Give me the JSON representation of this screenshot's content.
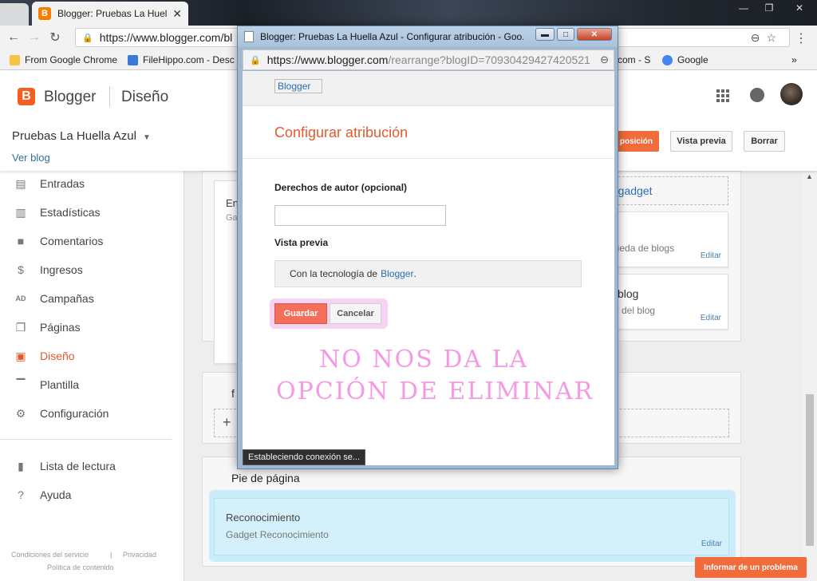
{
  "browser": {
    "tab_title": "Blogger: Pruebas La Huel",
    "address_url": "https://www.blogger.com/bl",
    "bookmarks": [
      "From Google Chrome",
      "FileHippo.com - Desc",
      "com - S",
      "Google"
    ]
  },
  "blogger": {
    "brand": "Blogger",
    "section": "Diseño",
    "blog_title": "Pruebas La Huella Azul",
    "view_blog": "Ver blog",
    "btn_save_arrangement": "posición",
    "btn_preview": "Vista previa",
    "btn_delete": "Borrar"
  },
  "sidebar": {
    "items": [
      {
        "label": "Entradas",
        "icon": "posts-icon"
      },
      {
        "label": "Estadísticas",
        "icon": "stats-icon"
      },
      {
        "label": "Comentarios",
        "icon": "comments-icon"
      },
      {
        "label": "Ingresos",
        "icon": "dollar-icon"
      },
      {
        "label": "Campañas",
        "icon": "ads-icon"
      },
      {
        "label": "Páginas",
        "icon": "pages-icon"
      },
      {
        "label": "Diseño",
        "icon": "layout-icon"
      },
      {
        "label": "Plantilla",
        "icon": "template-icon"
      },
      {
        "label": "Configuración",
        "icon": "gear-icon"
      }
    ],
    "secondary": [
      {
        "label": "Lista de lectura",
        "icon": "bookmark-icon"
      },
      {
        "label": "Ayuda",
        "icon": "help-icon"
      }
    ],
    "footer": {
      "terms": "Condiciones del servicio",
      "privacy": "Privacidad",
      "content_policy": "Política de contenido"
    }
  },
  "layout": {
    "gadget_left_title": "En",
    "gadget_left_sub": "Gad",
    "add_gadget": "n gadget",
    "search_gadget": "queda de blogs",
    "archive_title": "l blog",
    "archive_sub": "vo del blog",
    "edit": "Editar",
    "section_f": "f",
    "add_symbol": "+",
    "footer_section": "Pie de página",
    "recon_title": "Reconocimiento",
    "recon_sub": "Gadget Reconocimiento"
  },
  "report_button": "Informar de un problema",
  "popup": {
    "window_title": "Blogger: Pruebas La Huella Azul - Configurar atribución - Goo...",
    "url_host": "https://www.blogger.com",
    "url_path": "/rearrange?blogID=70930429427420521",
    "logo_alt": "Blogger",
    "heading": "Configurar atribución",
    "copyright_label": "Derechos de autor (opcional)",
    "copyright_value": "",
    "preview_label": "Vista previa",
    "preview_text": "Con la tecnología de",
    "preview_link": "Blogger",
    "preview_end": ".",
    "save": "Guardar",
    "cancel": "Cancelar",
    "status": "Estableciendo conexión se..."
  },
  "annotation": {
    "line1": "NO NOS DA LA",
    "line2": "OPCIÓN  DE ELIMINAR",
    "color": "#f49ae5"
  },
  "colors": {
    "accent": "#f26b3a",
    "link": "#2a6fb5",
    "popup_heading": "#e35b2e"
  }
}
